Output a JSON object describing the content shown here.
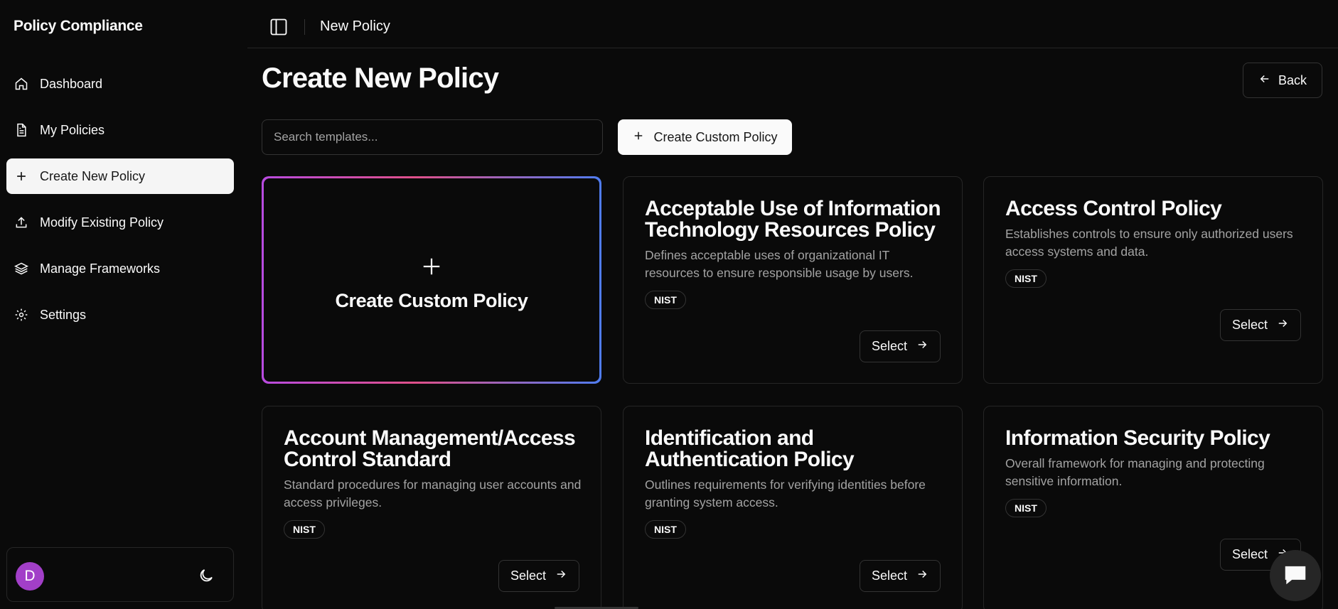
{
  "app": {
    "title": "Policy Compliance"
  },
  "sidebar": {
    "items": [
      {
        "label": "Dashboard",
        "icon": "home-icon"
      },
      {
        "label": "My Policies",
        "icon": "document-icon"
      },
      {
        "label": "Create New Policy",
        "icon": "plus-icon",
        "active": true
      },
      {
        "label": "Modify Existing Policy",
        "icon": "upload-icon"
      },
      {
        "label": "Manage Frameworks",
        "icon": "layers-icon"
      },
      {
        "label": "Settings",
        "icon": "gear-icon"
      }
    ],
    "user": {
      "initial": "D"
    }
  },
  "header": {
    "breadcrumb": "New Policy"
  },
  "main": {
    "title": "Create New Policy",
    "back_label": "Back",
    "search": {
      "placeholder": "Search templates...",
      "value": ""
    },
    "create_custom_label": "Create Custom Policy",
    "custom_card_label": "Create Custom Policy",
    "select_label": "Select",
    "templates": [
      {
        "title": "Acceptable Use of Information Technology Resources Policy",
        "description": "Defines acceptable uses of organizational IT resources to ensure responsible usage by users.",
        "badge": "NIST"
      },
      {
        "title": "Access Control Policy",
        "description": "Establishes controls to ensure only authorized users access systems and data.",
        "badge": "NIST"
      },
      {
        "title": "Account Management/Access Control Standard",
        "description": "Standard procedures for managing user accounts and access privileges.",
        "badge": "NIST"
      },
      {
        "title": "Identification and Authentication Policy",
        "description": "Outlines requirements for verifying identities before granting system access.",
        "badge": "NIST"
      },
      {
        "title": "Information Security Policy",
        "description": "Overall framework for managing and protecting sensitive information.",
        "badge": "NIST"
      }
    ]
  },
  "colors": {
    "accent_gradient": [
      "#b84be0",
      "#e0508a",
      "#4f7cf0"
    ],
    "avatar": "#a23fc8"
  }
}
